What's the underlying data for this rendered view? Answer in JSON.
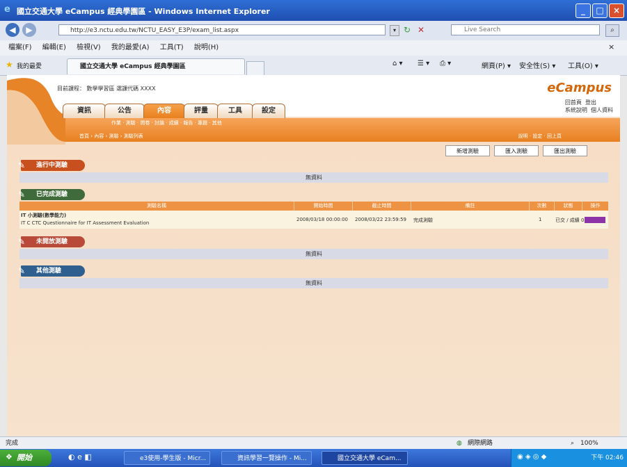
{
  "window": {
    "title": "國立交通大學 eCampus 經典學園區 - Windows Internet Explorer"
  },
  "address_bar": {
    "url": "http://e3.nctu.edu.tw/NCTU_EASY_E3P/exam_list.aspx",
    "search_placeholder": "Live Search"
  },
  "menu": [
    "檔案(F)",
    "編輯(E)",
    "檢視(V)",
    "我的最愛(A)",
    "工具(T)",
    "說明(H)"
  ],
  "favorites": {
    "label": "我的最愛",
    "tab_title": "國立交通大學 eCampus 經典學園區"
  },
  "toolbar": [
    "網頁(P) ▾",
    "安全性(S) ▾",
    "工具(O) ▾"
  ],
  "site": {
    "course_line": "目前課程： 數學學習區 選課代碼 XXXX",
    "logo": "eCampus",
    "header_links": [
      "回首頁",
      "登出",
      "系統說明",
      "個人資料"
    ],
    "tabs": [
      "資訊",
      "公告",
      "內容",
      "評量",
      "工具",
      "設定"
    ],
    "sub_menu": "作業 · 測驗 · 問卷 · 討論 · 成績 · 報告 · 專題 · 其他",
    "breadcrumb": "首頁 › 內容 › 測驗 › 測驗列表",
    "right_menu": "說明 · 設定 · 回上頁",
    "buttons": [
      "新增測驗",
      "匯入測驗",
      "匯出測驗"
    ]
  },
  "sections": {
    "ongoing": "進行中測驗",
    "finished": "已完成測驗",
    "not_open": "未開放測驗",
    "other": "其他測驗",
    "no_data": "無資料"
  },
  "table": {
    "headers": [
      "測驗名稱",
      "開始時間",
      "截止時間",
      "備註",
      "次數",
      "狀態",
      "操作"
    ],
    "row": {
      "title": "IT 小測驗(數學能力)",
      "subtitle": "IT C CTC Questionnaire for IT Assessment Evaluation",
      "start": "2008/03/18 00:00:00",
      "end": "2008/03/22 23:59:59",
      "note": "完成測驗",
      "count": "1",
      "status": "已交 / 成績 0"
    }
  },
  "status": {
    "left": "完成",
    "zone": "網際網路",
    "zoom": "100%"
  },
  "taskbar": {
    "start": "開始",
    "tasks": [
      "e3使用-學生版 - Micr...",
      "資訊學習一覽操作 - Mi...",
      "國立交通大學 eCam..."
    ],
    "clock": "下午 02:46"
  },
  "colors": {
    "accent_orange": "#e8801f",
    "title_blue": "#1f4fb0"
  }
}
